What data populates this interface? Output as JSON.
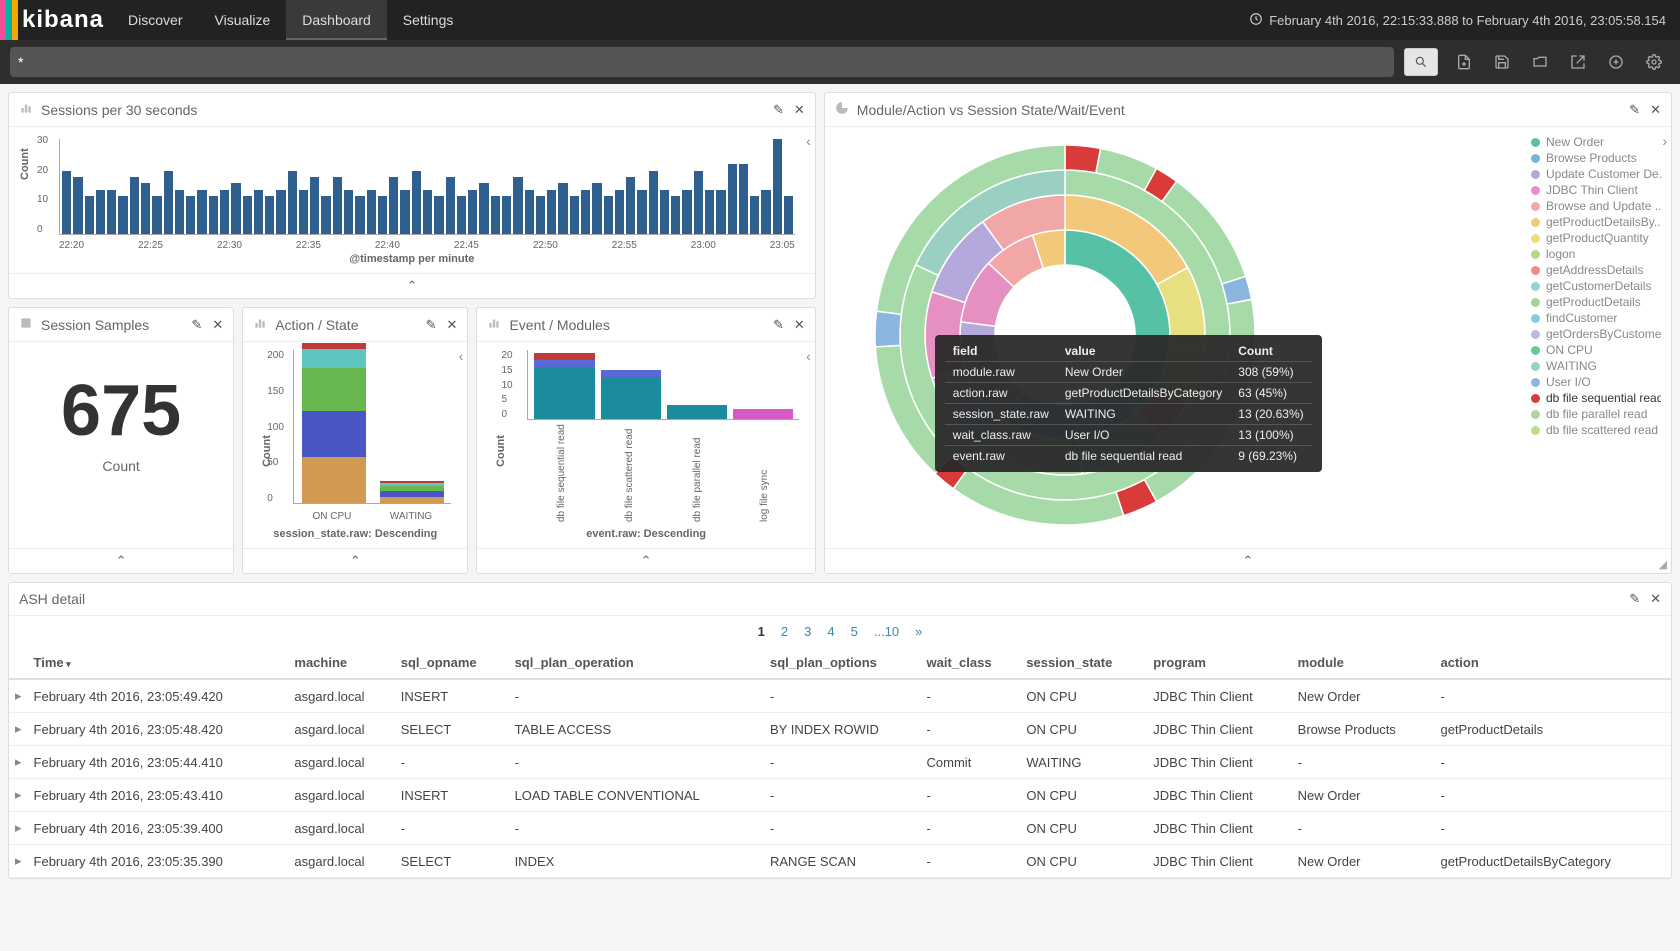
{
  "nav": {
    "brand": "kibana",
    "links": [
      "Discover",
      "Visualize",
      "Dashboard",
      "Settings"
    ],
    "active": "Dashboard",
    "timerange": "February 4th 2016, 22:15:33.888 to February 4th 2016, 23:05:58.154"
  },
  "toolbar": {
    "query": "*"
  },
  "panels": {
    "bar30s": {
      "title": "Sessions per 30 seconds",
      "ylabel": "Count",
      "xlabel": "@timestamp per minute"
    },
    "samples": {
      "title": "Session Samples",
      "value": "675",
      "label": "Count"
    },
    "actionstate": {
      "title": "Action / State",
      "ylabel": "Count",
      "xlabel": "session_state.raw: Descending"
    },
    "eventmod": {
      "title": "Event / Modules",
      "ylabel": "Count",
      "xlabel": "event.raw: Descending"
    },
    "sunburst": {
      "title": "Module/Action vs Session State/Wait/Event",
      "legend": [
        {
          "c": "#57c1a5",
          "t": "New Order"
        },
        {
          "c": "#7eb0d5",
          "t": "Browse Products"
        },
        {
          "c": "#b4a8dd",
          "t": "Update Customer De..."
        },
        {
          "c": "#e68fc1",
          "t": "JDBC Thin Client"
        },
        {
          "c": "#f2a7a7",
          "t": "Browse and Update ..."
        },
        {
          "c": "#f2c97b",
          "t": "getProductDetailsBy..."
        },
        {
          "c": "#e7e080",
          "t": "getProductQuantity"
        },
        {
          "c": "#b6d884",
          "t": "logon"
        },
        {
          "c": "#f08a8a",
          "t": "getAddressDetails"
        },
        {
          "c": "#8fd9c6",
          "t": "getCustomerDetails"
        },
        {
          "c": "#a6cf9a",
          "t": "getProductDetails"
        },
        {
          "c": "#86c9e0",
          "t": "findCustomer"
        },
        {
          "c": "#c1b3e6",
          "t": "getOrdersByCustomer"
        },
        {
          "c": "#5fc99f",
          "t": "ON CPU"
        },
        {
          "c": "#9ad0c2",
          "t": "WAITING"
        },
        {
          "c": "#8ab6e0",
          "t": "User I/O"
        },
        {
          "c": "#d93a3a",
          "t": "db file sequential read"
        },
        {
          "c": "#b7d19b",
          "t": "db file parallel read"
        },
        {
          "c": "#bde07f",
          "t": "db file scattered read"
        }
      ],
      "tooltip": {
        "headers": [
          "field",
          "value",
          "Count"
        ],
        "rows": [
          [
            "module.raw",
            "New Order",
            "308 (59%)"
          ],
          [
            "action.raw",
            "getProductDetailsByCategory",
            "63 (45%)"
          ],
          [
            "session_state.raw",
            "WAITING",
            "13 (20.63%)"
          ],
          [
            "wait_class.raw",
            "User I/O",
            "13 (100%)"
          ],
          [
            "event.raw",
            "db file sequential read",
            "9 (69.23%)"
          ]
        ]
      }
    },
    "ash": {
      "title": "ASH detail",
      "pages": [
        "1",
        "2",
        "3",
        "4",
        "5",
        "...10",
        "»"
      ],
      "current_page": "1",
      "columns": [
        "Time",
        "machine",
        "sql_opname",
        "sql_plan_operation",
        "sql_plan_options",
        "wait_class",
        "session_state",
        "program",
        "module",
        "action"
      ],
      "rows": [
        [
          "February 4th 2016, 23:05:49.420",
          "asgard.local",
          "INSERT",
          "-",
          "-",
          "-",
          "ON CPU",
          "JDBC Thin Client",
          "New Order",
          "-"
        ],
        [
          "February 4th 2016, 23:05:48.420",
          "asgard.local",
          "SELECT",
          "TABLE ACCESS",
          "BY INDEX ROWID",
          "-",
          "ON CPU",
          "JDBC Thin Client",
          "Browse Products",
          "getProductDetails"
        ],
        [
          "February 4th 2016, 23:05:44.410",
          "asgard.local",
          "-",
          "-",
          "-",
          "Commit",
          "WAITING",
          "JDBC Thin Client",
          "-",
          "-"
        ],
        [
          "February 4th 2016, 23:05:43.410",
          "asgard.local",
          "INSERT",
          "LOAD TABLE CONVENTIONAL",
          "-",
          "-",
          "ON CPU",
          "JDBC Thin Client",
          "New Order",
          "-"
        ],
        [
          "February 4th 2016, 23:05:39.400",
          "asgard.local",
          "-",
          "-",
          "-",
          "-",
          "ON CPU",
          "JDBC Thin Client",
          "-",
          "-"
        ],
        [
          "February 4th 2016, 23:05:35.390",
          "asgard.local",
          "SELECT",
          "INDEX",
          "RANGE SCAN",
          "-",
          "ON CPU",
          "JDBC Thin Client",
          "New Order",
          "getProductDetailsByCategory"
        ]
      ]
    }
  },
  "chart_data": {
    "sessions_per_30s": {
      "type": "bar",
      "ylabel": "Count",
      "xlabel": "@timestamp per minute",
      "ylim": [
        0,
        30
      ],
      "x_ticks": [
        "22:20",
        "22:25",
        "22:30",
        "22:35",
        "22:40",
        "22:45",
        "22:50",
        "22:55",
        "23:00",
        "23:05"
      ],
      "values": [
        20,
        18,
        12,
        14,
        14,
        12,
        18,
        16,
        12,
        20,
        14,
        12,
        14,
        12,
        14,
        16,
        12,
        14,
        12,
        14,
        20,
        14,
        18,
        12,
        18,
        14,
        12,
        14,
        12,
        18,
        14,
        20,
        14,
        12,
        18,
        12,
        14,
        16,
        12,
        12,
        18,
        14,
        12,
        14,
        16,
        12,
        14,
        16,
        12,
        14,
        18,
        14,
        20,
        14,
        12,
        14,
        20,
        14,
        14,
        22,
        22,
        12,
        14,
        30,
        12
      ]
    },
    "action_state": {
      "type": "stacked_bar",
      "ylabel": "Count",
      "xlabel": "session_state.raw: Descending",
      "ylim": [
        0,
        200
      ],
      "categories": [
        "ON CPU",
        "WAITING"
      ],
      "series": [
        {
          "name": "s1",
          "color": "#d19a52",
          "values": [
            60,
            8
          ]
        },
        {
          "name": "s2",
          "color": "#4a55c6",
          "values": [
            60,
            8
          ]
        },
        {
          "name": "s3",
          "color": "#66b84f",
          "values": [
            55,
            6
          ]
        },
        {
          "name": "s4",
          "color": "#5ec5c0",
          "values": [
            25,
            4
          ]
        },
        {
          "name": "s5",
          "color": "#c13a3a",
          "values": [
            8,
            2
          ]
        }
      ]
    },
    "event_modules": {
      "type": "stacked_bar",
      "ylabel": "Count",
      "xlabel": "event.raw: Descending",
      "ylim": [
        0,
        20
      ],
      "categories": [
        "db file sequential read",
        "db file scattered read",
        "db file parallel read",
        "log file sync"
      ],
      "series": [
        {
          "name": "s1",
          "color": "#1a8c9e",
          "values": [
            15,
            12,
            4,
            0
          ]
        },
        {
          "name": "s2",
          "color": "#5a69d6",
          "values": [
            2,
            2,
            0,
            0
          ]
        },
        {
          "name": "s3",
          "color": "#c13a3a",
          "values": [
            2,
            0,
            0,
            0
          ]
        },
        {
          "name": "s4",
          "color": "#d65ac4",
          "values": [
            0,
            0,
            0,
            3
          ]
        }
      ]
    }
  }
}
